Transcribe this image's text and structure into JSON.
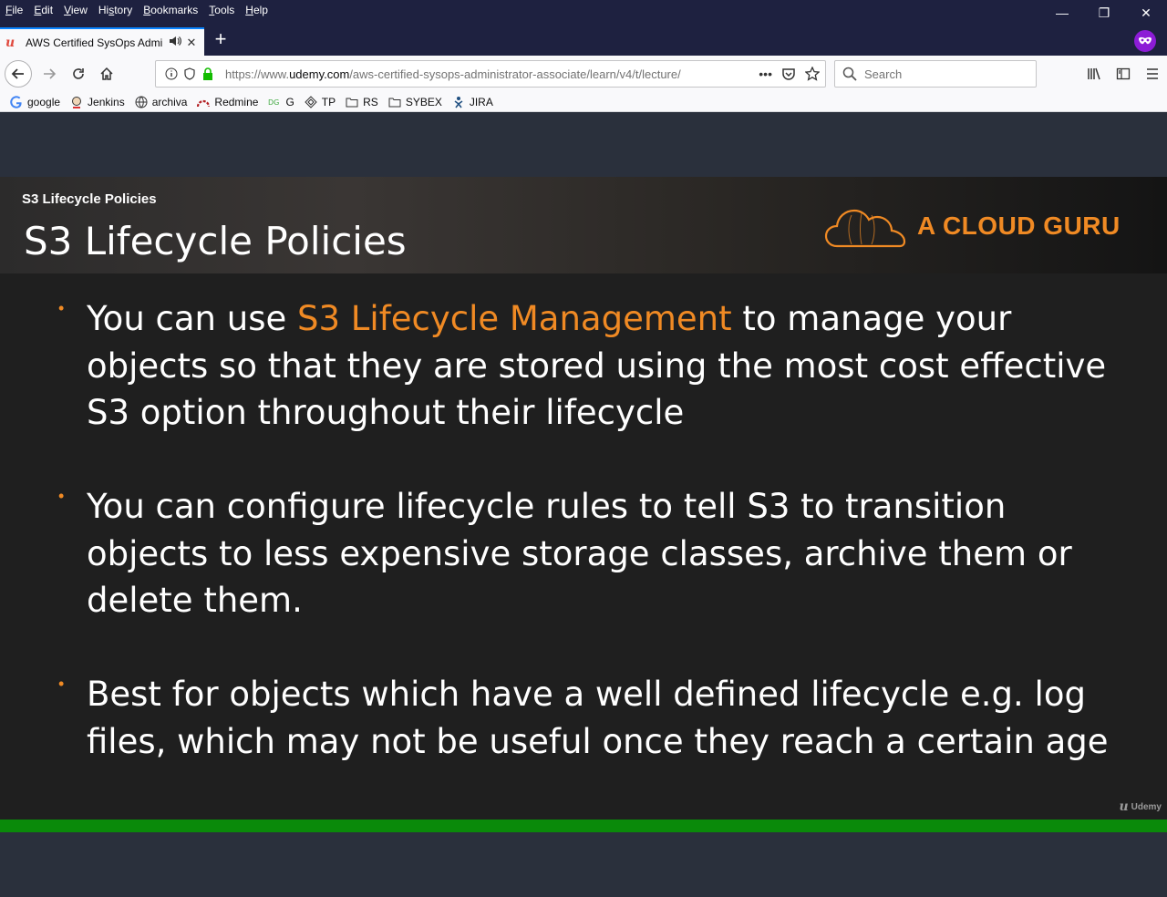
{
  "menu": [
    "File",
    "Edit",
    "View",
    "History",
    "Bookmarks",
    "Tools",
    "Help"
  ],
  "menu_accel": [
    "F",
    "E",
    "V",
    "s",
    "B",
    "T",
    "H"
  ],
  "window_controls": {
    "minimize": "—",
    "restore": "❐",
    "close": "✕"
  },
  "tab": {
    "title": "AWS Certified SysOps Admi",
    "favicon": "u",
    "audio_icon": "speaker-icon",
    "close_icon": "✕"
  },
  "newtab": "+",
  "url": {
    "prefix": "https://www.",
    "domain": "udemy.com",
    "path": "/aws-certified-sysops-administrator-associate/learn/v4/t/lecture/"
  },
  "search": {
    "placeholder": "Search"
  },
  "bookmarks": [
    {
      "label": "google",
      "icon": "google-icon"
    },
    {
      "label": "Jenkins",
      "icon": "jenkins-icon"
    },
    {
      "label": "archiva",
      "icon": "globe-icon"
    },
    {
      "label": "Redmine",
      "icon": "redmine-icon"
    },
    {
      "label": "G",
      "icon": "dg-icon"
    },
    {
      "label": "TP",
      "icon": "tp-icon"
    },
    {
      "label": "RS",
      "icon": "folder-icon"
    },
    {
      "label": "SYBEX",
      "icon": "folder-icon"
    },
    {
      "label": "JIRA",
      "icon": "jira-icon"
    }
  ],
  "slide": {
    "small_title": "S3 Lifecycle Policies",
    "title": "S3 Lifecycle Policies",
    "logo_text": "A CLOUD GURU",
    "bullets": [
      {
        "pre": "You can use ",
        "highlight": "S3 Lifecycle Management",
        "post": " to manage your objects so that they are stored using the most cost effective S3 option throughout their lifecycle"
      },
      {
        "pre": "You can configure lifecycle rules to tell S3 to transition objects to less expensive storage classes, archive them or delete them.",
        "highlight": "",
        "post": ""
      },
      {
        "pre": "Best for objects which have a well defined lifecycle e.g. log files, which may not be useful once they reach a certain age",
        "highlight": "",
        "post": ""
      }
    ],
    "watermark": "Udemy",
    "bullet_symbol": "•"
  },
  "colors": {
    "accent": "#f08a24",
    "progress": "#0a8a0a",
    "chrome_dark": "#1e2140"
  }
}
